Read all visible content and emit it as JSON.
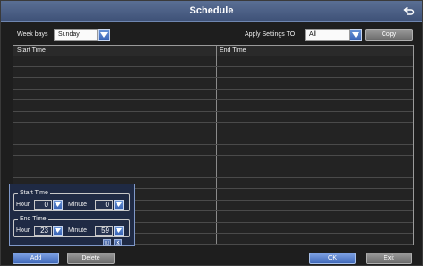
{
  "window": {
    "title": "Schedule"
  },
  "toolbar": {
    "weekdays_label": "Week bays",
    "weekdays_value": "Sunday",
    "apply_label": "Apply Settings TO",
    "apply_value": "All",
    "copy_label": "Copy"
  },
  "table": {
    "columns": [
      "Start Time",
      "End Time"
    ],
    "row_count": 17
  },
  "editor": {
    "start_legend": "Start Time",
    "end_legend": "End Time",
    "hour_label": "Hour",
    "minute_label": "Minute",
    "start_hour": "0",
    "start_minute": "0",
    "end_hour": "23",
    "end_minute": "59"
  },
  "footer": {
    "add_label": "Add",
    "delete_label": "Delete",
    "ok_label": "OK",
    "exit_label": "Exit"
  },
  "colors": {
    "accent_blue": "#3e67b8",
    "title_bar": "#4a5e85",
    "background": "#1e1e1e"
  }
}
